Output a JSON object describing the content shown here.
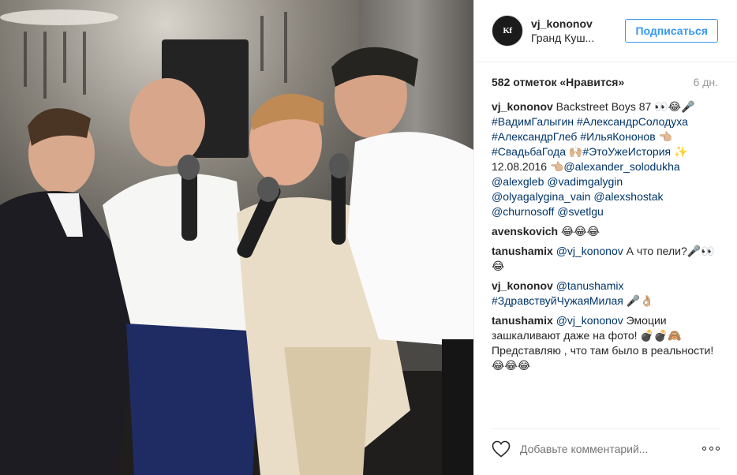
{
  "header": {
    "username": "vj_kononov",
    "location": "Гранд Куш...",
    "follow_label": "Подписаться",
    "avatar_text": "Kf"
  },
  "stats": {
    "likes": "582 отметок «Нравится»",
    "age": "6 дн."
  },
  "comments": [
    {
      "user": "vj_kononov",
      "parts": [
        {
          "t": "text",
          "v": " Backstreet Boys 87 👀😂🎤"
        },
        {
          "t": "tag",
          "v": "#ВадимГалыгин"
        },
        {
          "t": "text",
          "v": " "
        },
        {
          "t": "tag",
          "v": "#АлександрСолодуха"
        },
        {
          "t": "text",
          "v": " "
        },
        {
          "t": "tag",
          "v": "#АлександрГлеб"
        },
        {
          "t": "text",
          "v": " "
        },
        {
          "t": "tag",
          "v": "#ИльяКононов"
        },
        {
          "t": "text",
          "v": " 👈🏼 "
        },
        {
          "t": "tag",
          "v": "#СвадьбаГода"
        },
        {
          "t": "text",
          "v": " 🙌🏼"
        },
        {
          "t": "tag",
          "v": "#ЭтоУжеИстория"
        },
        {
          "t": "text",
          "v": " ✨ 12.08.2016 👈🏼"
        },
        {
          "t": "tag",
          "v": "@alexander_solodukha"
        },
        {
          "t": "text",
          "v": " "
        },
        {
          "t": "tag",
          "v": "@alexgleb"
        },
        {
          "t": "text",
          "v": " "
        },
        {
          "t": "tag",
          "v": "@vadimgalygin"
        },
        {
          "t": "text",
          "v": " "
        },
        {
          "t": "tag",
          "v": "@olyagalygina_vain"
        },
        {
          "t": "text",
          "v": " "
        },
        {
          "t": "tag",
          "v": "@alexshostak"
        },
        {
          "t": "text",
          "v": " "
        },
        {
          "t": "tag",
          "v": "@churnosoff"
        },
        {
          "t": "text",
          "v": " "
        },
        {
          "t": "tag",
          "v": "@svetlgu"
        }
      ]
    },
    {
      "user": "avenskovich",
      "parts": [
        {
          "t": "text",
          "v": " 😂😂😂"
        }
      ]
    },
    {
      "user": "tanushamix",
      "parts": [
        {
          "t": "text",
          "v": " "
        },
        {
          "t": "tag",
          "v": "@vj_kononov"
        },
        {
          "t": "text",
          "v": " А что пели?🎤👀😂"
        }
      ]
    },
    {
      "user": "vj_kononov",
      "parts": [
        {
          "t": "text",
          "v": " "
        },
        {
          "t": "tag",
          "v": "@tanushamix"
        },
        {
          "t": "text",
          "v": " "
        },
        {
          "t": "tag",
          "v": "#ЗдравствуйЧужаяМилая"
        },
        {
          "t": "text",
          "v": " 🎤👌🏼"
        }
      ]
    },
    {
      "user": "tanushamix",
      "parts": [
        {
          "t": "text",
          "v": " "
        },
        {
          "t": "tag",
          "v": "@vj_kononov"
        },
        {
          "t": "text",
          "v": " Эмоции зашкаливают даже на фото! 💣💣🙈 Представляю , что там было в реальности!😂😂😂"
        }
      ]
    }
  ],
  "footer": {
    "comment_placeholder": "Добавьте комментарий...",
    "like_icon": "heart-icon",
    "more_icon": "more-options-icon"
  },
  "colors": {
    "accent": "#3897f0",
    "link": "#003569",
    "muted": "#999999"
  }
}
